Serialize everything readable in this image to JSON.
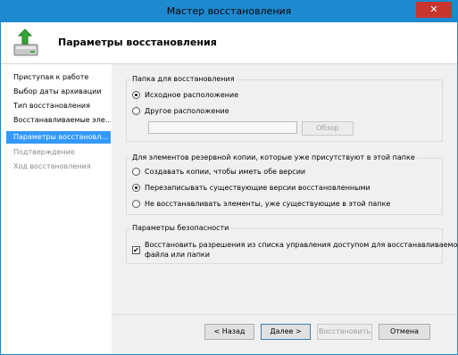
{
  "window": {
    "title": "Мастер восстановления",
    "close_label": "✕"
  },
  "header": {
    "title": "Параметры восстановления",
    "icon": "backup-recovery-icon"
  },
  "steps": [
    {
      "label": "Приступая к работе",
      "state": "normal"
    },
    {
      "label": "Выбор даты архивации",
      "state": "normal"
    },
    {
      "label": "Тип восстановления",
      "state": "normal"
    },
    {
      "label": "Восстанавливаемые эле...",
      "state": "normal"
    },
    {
      "label": "Параметры восстановл...",
      "state": "active"
    },
    {
      "label": "Подтверждение",
      "state": "disabled"
    },
    {
      "label": "Ход восстановления",
      "state": "disabled"
    }
  ],
  "location_group": {
    "title": "Папка для восстановления",
    "options": [
      {
        "label": "Исходное расположение",
        "checked": true
      },
      {
        "label": "Другое расположение",
        "checked": false
      }
    ],
    "path_value": "",
    "browse_label": "Обзор"
  },
  "existing_group": {
    "title": "Для элементов резервной копии, которые уже присутствуют в этой папке",
    "options": [
      {
        "label": "Создавать копии, чтобы иметь обе версии",
        "checked": false
      },
      {
        "label": "Перезаписывать существующие версии восстановленными",
        "checked": true
      },
      {
        "label": "Не восстанавливать элементы, уже существующие в этой папке",
        "checked": false
      }
    ]
  },
  "security_group": {
    "title": "Параметры безопасности",
    "checkbox_label_line1": "Восстановить разрешения из списка управления доступом для восстанавливаемого",
    "checkbox_label_line2": "файла или папки",
    "checked": true
  },
  "buttons": {
    "back": "< Назад",
    "next": "Далее >",
    "restore": "Восстановить",
    "cancel": "Отмена"
  },
  "colors": {
    "titlebar": "#1d8ad0",
    "active_step": "#3399ff",
    "close": "#c7352d"
  }
}
